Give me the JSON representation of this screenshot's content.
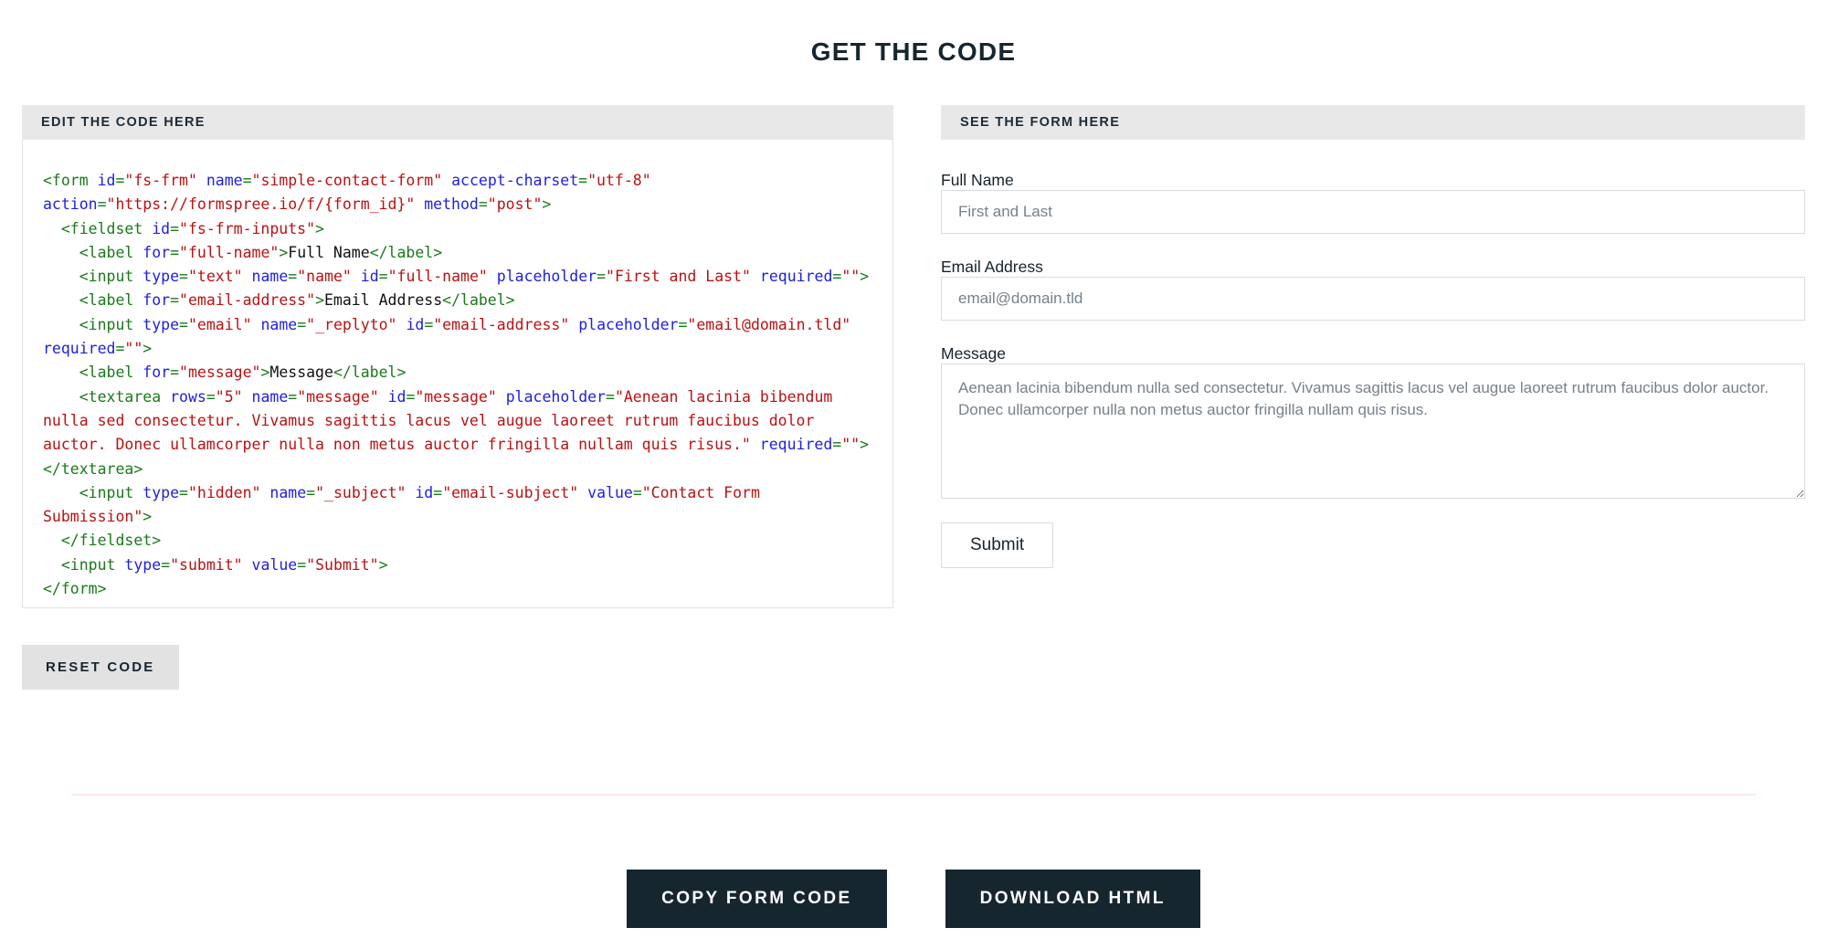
{
  "page": {
    "title": "GET THE CODE"
  },
  "editor_panel": {
    "header": "EDIT THE CODE HERE",
    "code_lines": [
      {
        "indent": 0,
        "tokens": [
          {
            "t": "tag",
            "v": "<form "
          },
          {
            "t": "attr",
            "v": "id"
          },
          {
            "t": "tag",
            "v": "="
          },
          {
            "t": "val",
            "v": "\"fs-frm\""
          },
          {
            "t": "tag",
            "v": " "
          },
          {
            "t": "attr",
            "v": "name"
          },
          {
            "t": "tag",
            "v": "="
          },
          {
            "t": "val",
            "v": "\"simple-contact-form\""
          },
          {
            "t": "tag",
            "v": " "
          },
          {
            "t": "attr",
            "v": "accept-charset"
          },
          {
            "t": "tag",
            "v": "="
          },
          {
            "t": "val",
            "v": "\"utf-8\""
          },
          {
            "t": "tag",
            "v": " "
          },
          {
            "t": "attr",
            "v": "action"
          },
          {
            "t": "tag",
            "v": "="
          },
          {
            "t": "val",
            "v": "\"https://formspree.io/f/{form_id}\""
          },
          {
            "t": "tag",
            "v": " "
          },
          {
            "t": "attr",
            "v": "method"
          },
          {
            "t": "tag",
            "v": "="
          },
          {
            "t": "val",
            "v": "\"post\""
          },
          {
            "t": "tag",
            "v": ">"
          }
        ]
      },
      {
        "indent": 1,
        "tokens": [
          {
            "t": "tag",
            "v": "<fieldset "
          },
          {
            "t": "attr",
            "v": "id"
          },
          {
            "t": "tag",
            "v": "="
          },
          {
            "t": "val",
            "v": "\"fs-frm-inputs\""
          },
          {
            "t": "tag",
            "v": ">"
          }
        ]
      },
      {
        "indent": 2,
        "tokens": [
          {
            "t": "tag",
            "v": "<label "
          },
          {
            "t": "attr",
            "v": "for"
          },
          {
            "t": "tag",
            "v": "="
          },
          {
            "t": "val",
            "v": "\"full-name\""
          },
          {
            "t": "tag",
            "v": ">"
          },
          {
            "t": "txt",
            "v": "Full Name"
          },
          {
            "t": "tag",
            "v": "</label>"
          }
        ]
      },
      {
        "indent": 2,
        "tokens": [
          {
            "t": "tag",
            "v": "<input "
          },
          {
            "t": "attr",
            "v": "type"
          },
          {
            "t": "tag",
            "v": "="
          },
          {
            "t": "val",
            "v": "\"text\""
          },
          {
            "t": "tag",
            "v": " "
          },
          {
            "t": "attr",
            "v": "name"
          },
          {
            "t": "tag",
            "v": "="
          },
          {
            "t": "val",
            "v": "\"name\""
          },
          {
            "t": "tag",
            "v": " "
          },
          {
            "t": "attr",
            "v": "id"
          },
          {
            "t": "tag",
            "v": "="
          },
          {
            "t": "val",
            "v": "\"full-name\""
          },
          {
            "t": "tag",
            "v": " "
          },
          {
            "t": "attr",
            "v": "placeholder"
          },
          {
            "t": "tag",
            "v": "="
          },
          {
            "t": "val",
            "v": "\"First and Last\""
          },
          {
            "t": "tag",
            "v": " "
          },
          {
            "t": "attr",
            "v": "required"
          },
          {
            "t": "tag",
            "v": "="
          },
          {
            "t": "val",
            "v": "\"\""
          },
          {
            "t": "tag",
            "v": ">"
          }
        ]
      },
      {
        "indent": 2,
        "tokens": [
          {
            "t": "tag",
            "v": "<label "
          },
          {
            "t": "attr",
            "v": "for"
          },
          {
            "t": "tag",
            "v": "="
          },
          {
            "t": "val",
            "v": "\"email-address\""
          },
          {
            "t": "tag",
            "v": ">"
          },
          {
            "t": "txt",
            "v": "Email Address"
          },
          {
            "t": "tag",
            "v": "</label>"
          }
        ]
      },
      {
        "indent": 2,
        "tokens": [
          {
            "t": "tag",
            "v": "<input "
          },
          {
            "t": "attr",
            "v": "type"
          },
          {
            "t": "tag",
            "v": "="
          },
          {
            "t": "val",
            "v": "\"email\""
          },
          {
            "t": "tag",
            "v": " "
          },
          {
            "t": "attr",
            "v": "name"
          },
          {
            "t": "tag",
            "v": "="
          },
          {
            "t": "val",
            "v": "\"_replyto\""
          },
          {
            "t": "tag",
            "v": " "
          },
          {
            "t": "attr",
            "v": "id"
          },
          {
            "t": "tag",
            "v": "="
          },
          {
            "t": "val",
            "v": "\"email-address\""
          },
          {
            "t": "tag",
            "v": " "
          },
          {
            "t": "attr",
            "v": "placeholder"
          },
          {
            "t": "tag",
            "v": "="
          },
          {
            "t": "val",
            "v": "\"email@domain.tld\""
          },
          {
            "t": "tag",
            "v": " "
          },
          {
            "t": "attr",
            "v": "required"
          },
          {
            "t": "tag",
            "v": "="
          },
          {
            "t": "val",
            "v": "\"\""
          },
          {
            "t": "tag",
            "v": ">"
          }
        ]
      },
      {
        "indent": 2,
        "tokens": [
          {
            "t": "tag",
            "v": "<label "
          },
          {
            "t": "attr",
            "v": "for"
          },
          {
            "t": "tag",
            "v": "="
          },
          {
            "t": "val",
            "v": "\"message\""
          },
          {
            "t": "tag",
            "v": ">"
          },
          {
            "t": "txt",
            "v": "Message"
          },
          {
            "t": "tag",
            "v": "</label>"
          }
        ]
      },
      {
        "indent": 2,
        "tokens": [
          {
            "t": "tag",
            "v": "<textarea "
          },
          {
            "t": "attr",
            "v": "rows"
          },
          {
            "t": "tag",
            "v": "="
          },
          {
            "t": "val",
            "v": "\"5\""
          },
          {
            "t": "tag",
            "v": " "
          },
          {
            "t": "attr",
            "v": "name"
          },
          {
            "t": "tag",
            "v": "="
          },
          {
            "t": "val",
            "v": "\"message\""
          },
          {
            "t": "tag",
            "v": " "
          },
          {
            "t": "attr",
            "v": "id"
          },
          {
            "t": "tag",
            "v": "="
          },
          {
            "t": "val",
            "v": "\"message\""
          },
          {
            "t": "tag",
            "v": " "
          },
          {
            "t": "attr",
            "v": "placeholder"
          },
          {
            "t": "tag",
            "v": "="
          },
          {
            "t": "val",
            "v": "\"Aenean lacinia bibendum nulla sed consectetur. Vivamus sagittis lacus vel augue laoreet rutrum faucibus dolor auctor. Donec ullamcorper nulla non metus auctor fringilla nullam quis risus.\""
          },
          {
            "t": "tag",
            "v": " "
          },
          {
            "t": "attr",
            "v": "required"
          },
          {
            "t": "tag",
            "v": "="
          },
          {
            "t": "val",
            "v": "\"\""
          },
          {
            "t": "tag",
            "v": "></textarea>"
          }
        ]
      },
      {
        "indent": 2,
        "tokens": [
          {
            "t": "tag",
            "v": "<input "
          },
          {
            "t": "attr",
            "v": "type"
          },
          {
            "t": "tag",
            "v": "="
          },
          {
            "t": "val",
            "v": "\"hidden\""
          },
          {
            "t": "tag",
            "v": " "
          },
          {
            "t": "attr",
            "v": "name"
          },
          {
            "t": "tag",
            "v": "="
          },
          {
            "t": "val",
            "v": "\"_subject\""
          },
          {
            "t": "tag",
            "v": " "
          },
          {
            "t": "attr",
            "v": "id"
          },
          {
            "t": "tag",
            "v": "="
          },
          {
            "t": "val",
            "v": "\"email-subject\""
          },
          {
            "t": "tag",
            "v": " "
          },
          {
            "t": "attr",
            "v": "value"
          },
          {
            "t": "tag",
            "v": "="
          },
          {
            "t": "val",
            "v": "\"Contact Form Submission\""
          },
          {
            "t": "tag",
            "v": ">"
          }
        ]
      },
      {
        "indent": 1,
        "tokens": [
          {
            "t": "tag",
            "v": "</fieldset>"
          }
        ]
      },
      {
        "indent": 1,
        "tokens": [
          {
            "t": "tag",
            "v": "<input "
          },
          {
            "t": "attr",
            "v": "type"
          },
          {
            "t": "tag",
            "v": "="
          },
          {
            "t": "val",
            "v": "\"submit\""
          },
          {
            "t": "tag",
            "v": " "
          },
          {
            "t": "attr",
            "v": "value"
          },
          {
            "t": "tag",
            "v": "="
          },
          {
            "t": "val",
            "v": "\"Submit\""
          },
          {
            "t": "tag",
            "v": ">"
          }
        ]
      },
      {
        "indent": 0,
        "tokens": [
          {
            "t": "tag",
            "v": "</form>"
          }
        ]
      }
    ],
    "reset_button": "RESET CODE"
  },
  "preview_panel": {
    "header": "SEE THE FORM HERE",
    "fields": {
      "full_name": {
        "label": "Full Name",
        "value": "",
        "placeholder": "First and Last"
      },
      "email": {
        "label": "Email Address",
        "value": "",
        "placeholder": "email@domain.tld"
      },
      "message": {
        "label": "Message",
        "value": "",
        "placeholder": "Aenean lacinia bibendum nulla sed consectetur. Vivamus sagittis lacus vel augue laoreet rutrum faucibus dolor auctor. Donec ullamcorper nulla non metus auctor fringilla nullam quis risus."
      }
    },
    "submit_button": "Submit"
  },
  "footer": {
    "copy_button": "COPY FORM CODE",
    "download_button": "DOWNLOAD HTML"
  },
  "colors": {
    "navy": "#16262f",
    "panel_header_bg": "#e8e8e8",
    "reset_bg": "#e2e2e2",
    "divider": "#fbe9ea",
    "code_tag": "#1a7a1a",
    "code_attr": "#2020e0",
    "code_value": "#bb1111",
    "border": "#d8dcde"
  }
}
